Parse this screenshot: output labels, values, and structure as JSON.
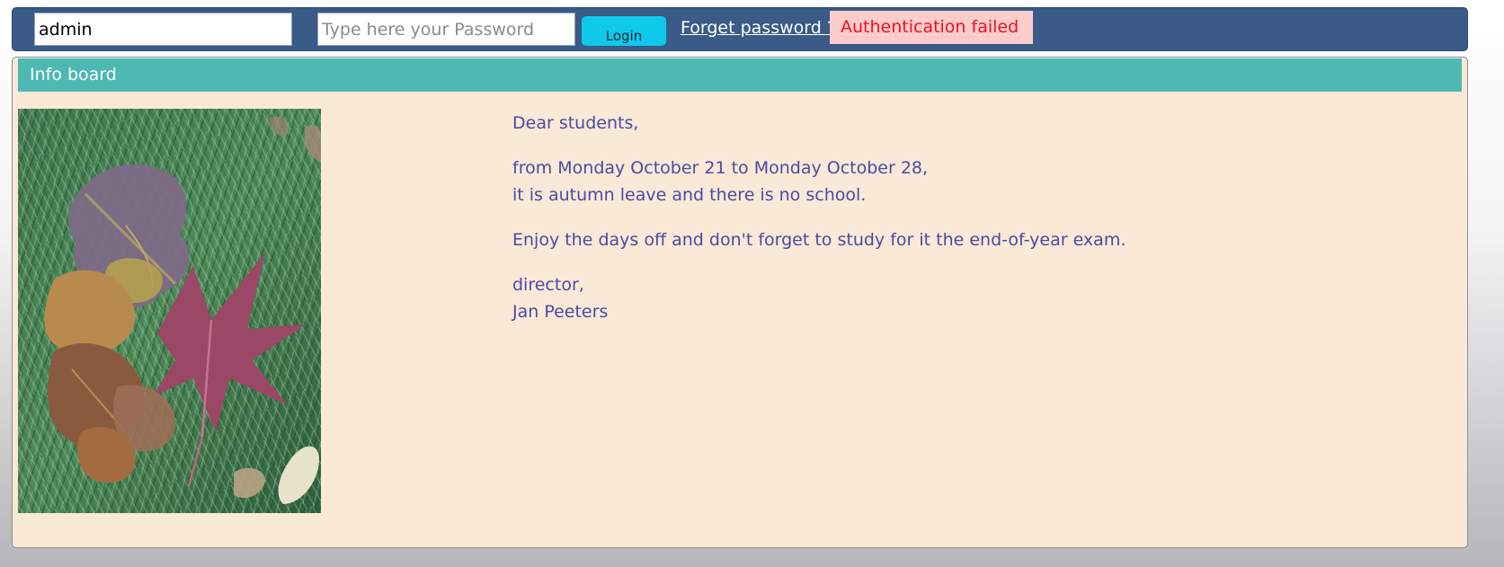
{
  "login": {
    "username_value": "admin",
    "password_placeholder": "Type here your Password",
    "login_label": "Login",
    "forget_label": "Forget password ?",
    "error_message": "Authentication failed"
  },
  "board": {
    "title": "Info board",
    "message": {
      "greeting": "Dear students,",
      "period_line1": "from Monday October 21 to Monday October 28,",
      "period_line2": "it is autumn leave and there is no school.",
      "reminder": "Enjoy the days off and don't forget to study for it the end-of-year exam.",
      "signature_role": "director,",
      "signature_name": "Jan Peeters"
    }
  },
  "colors": {
    "topbar": "#3a5a87",
    "login_button": "#0ec9ea",
    "error_bg": "#ffcccc",
    "error_text": "#e8121f",
    "board_bg": "#fae9d6",
    "board_header": "#4eb8b3",
    "message_text": "#4a4aa6"
  },
  "image": {
    "subject": "autumn-leaves-on-grass"
  }
}
